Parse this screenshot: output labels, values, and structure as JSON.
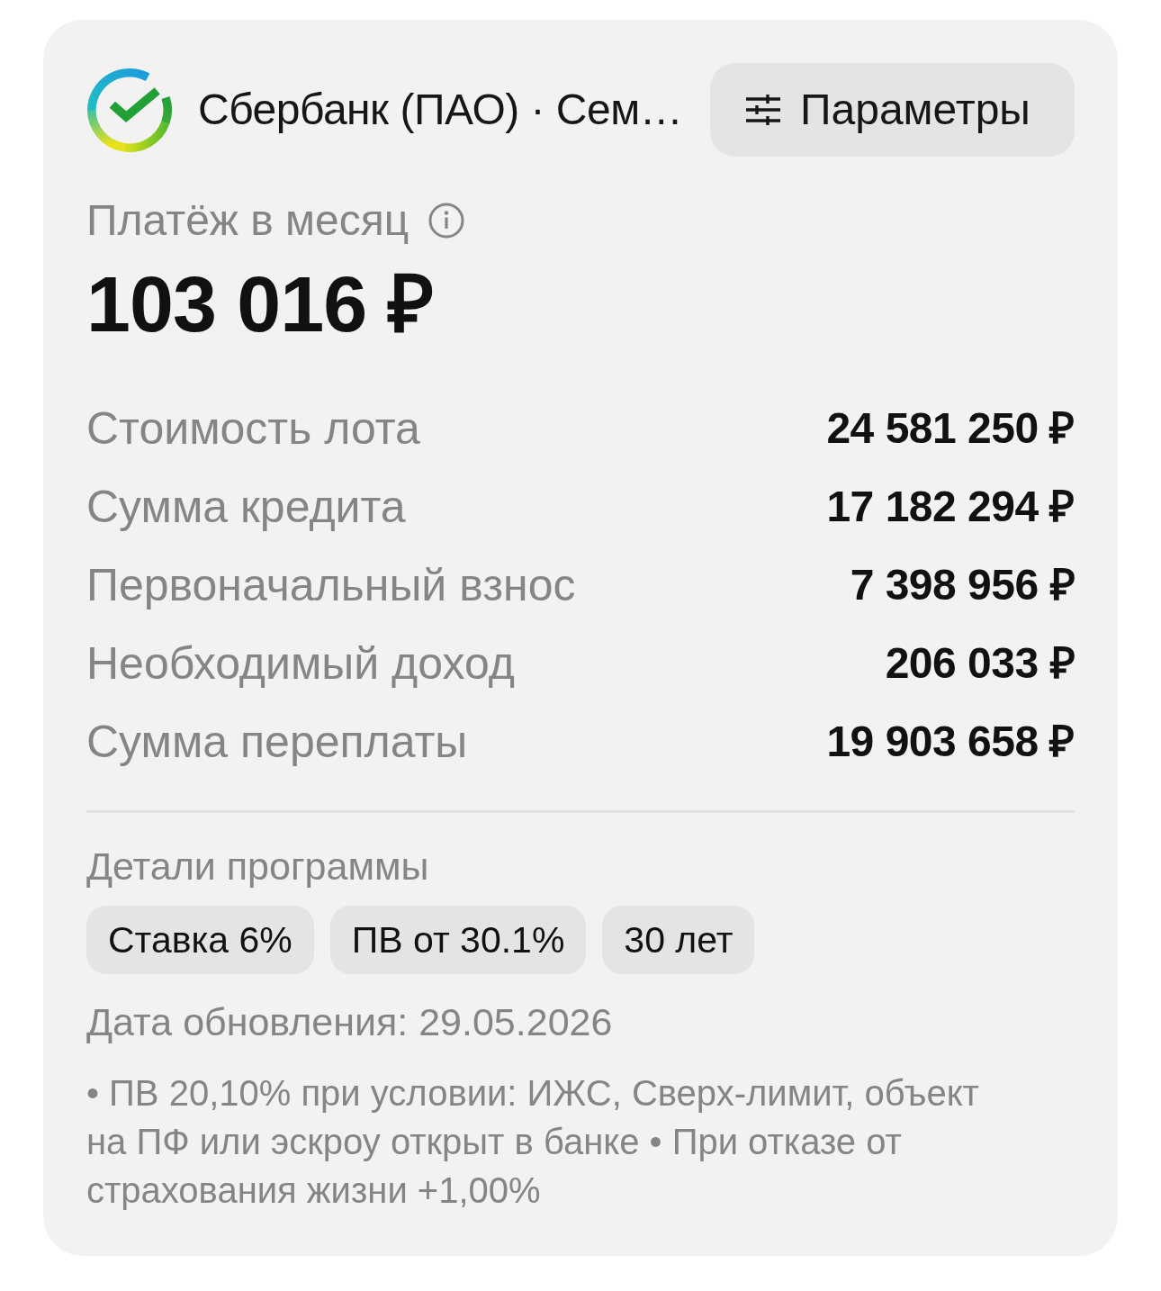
{
  "header": {
    "title": "Сбербанк (ПАО) · Сем…",
    "params_button": {
      "label": "Параметры"
    }
  },
  "payment": {
    "label": "Платёж в месяц",
    "amount": "103 016 ₽"
  },
  "rows": [
    {
      "label": "Стоимость лота",
      "value": "24 581 250 ₽"
    },
    {
      "label": "Сумма кредита",
      "value": "17 182 294 ₽"
    },
    {
      "label": "Первоначальный взнос",
      "value": "7 398 956 ₽"
    },
    {
      "label": "Необходимый доход",
      "value": "206 033 ₽"
    },
    {
      "label": "Сумма переплаты",
      "value": "19 903 658 ₽"
    }
  ],
  "program": {
    "title": "Детали программы",
    "tags": [
      "Ставка 6%",
      "ПВ от 30.1%",
      "30 лет"
    ],
    "updated": "Дата обновления: 29.05.2026",
    "note": "• ПВ 20,10% при условии: ИЖС, Сверх-лимит, объект на ПФ или эскроу открыт в банке • При отказе от страхования жизни +1,00%"
  }
}
